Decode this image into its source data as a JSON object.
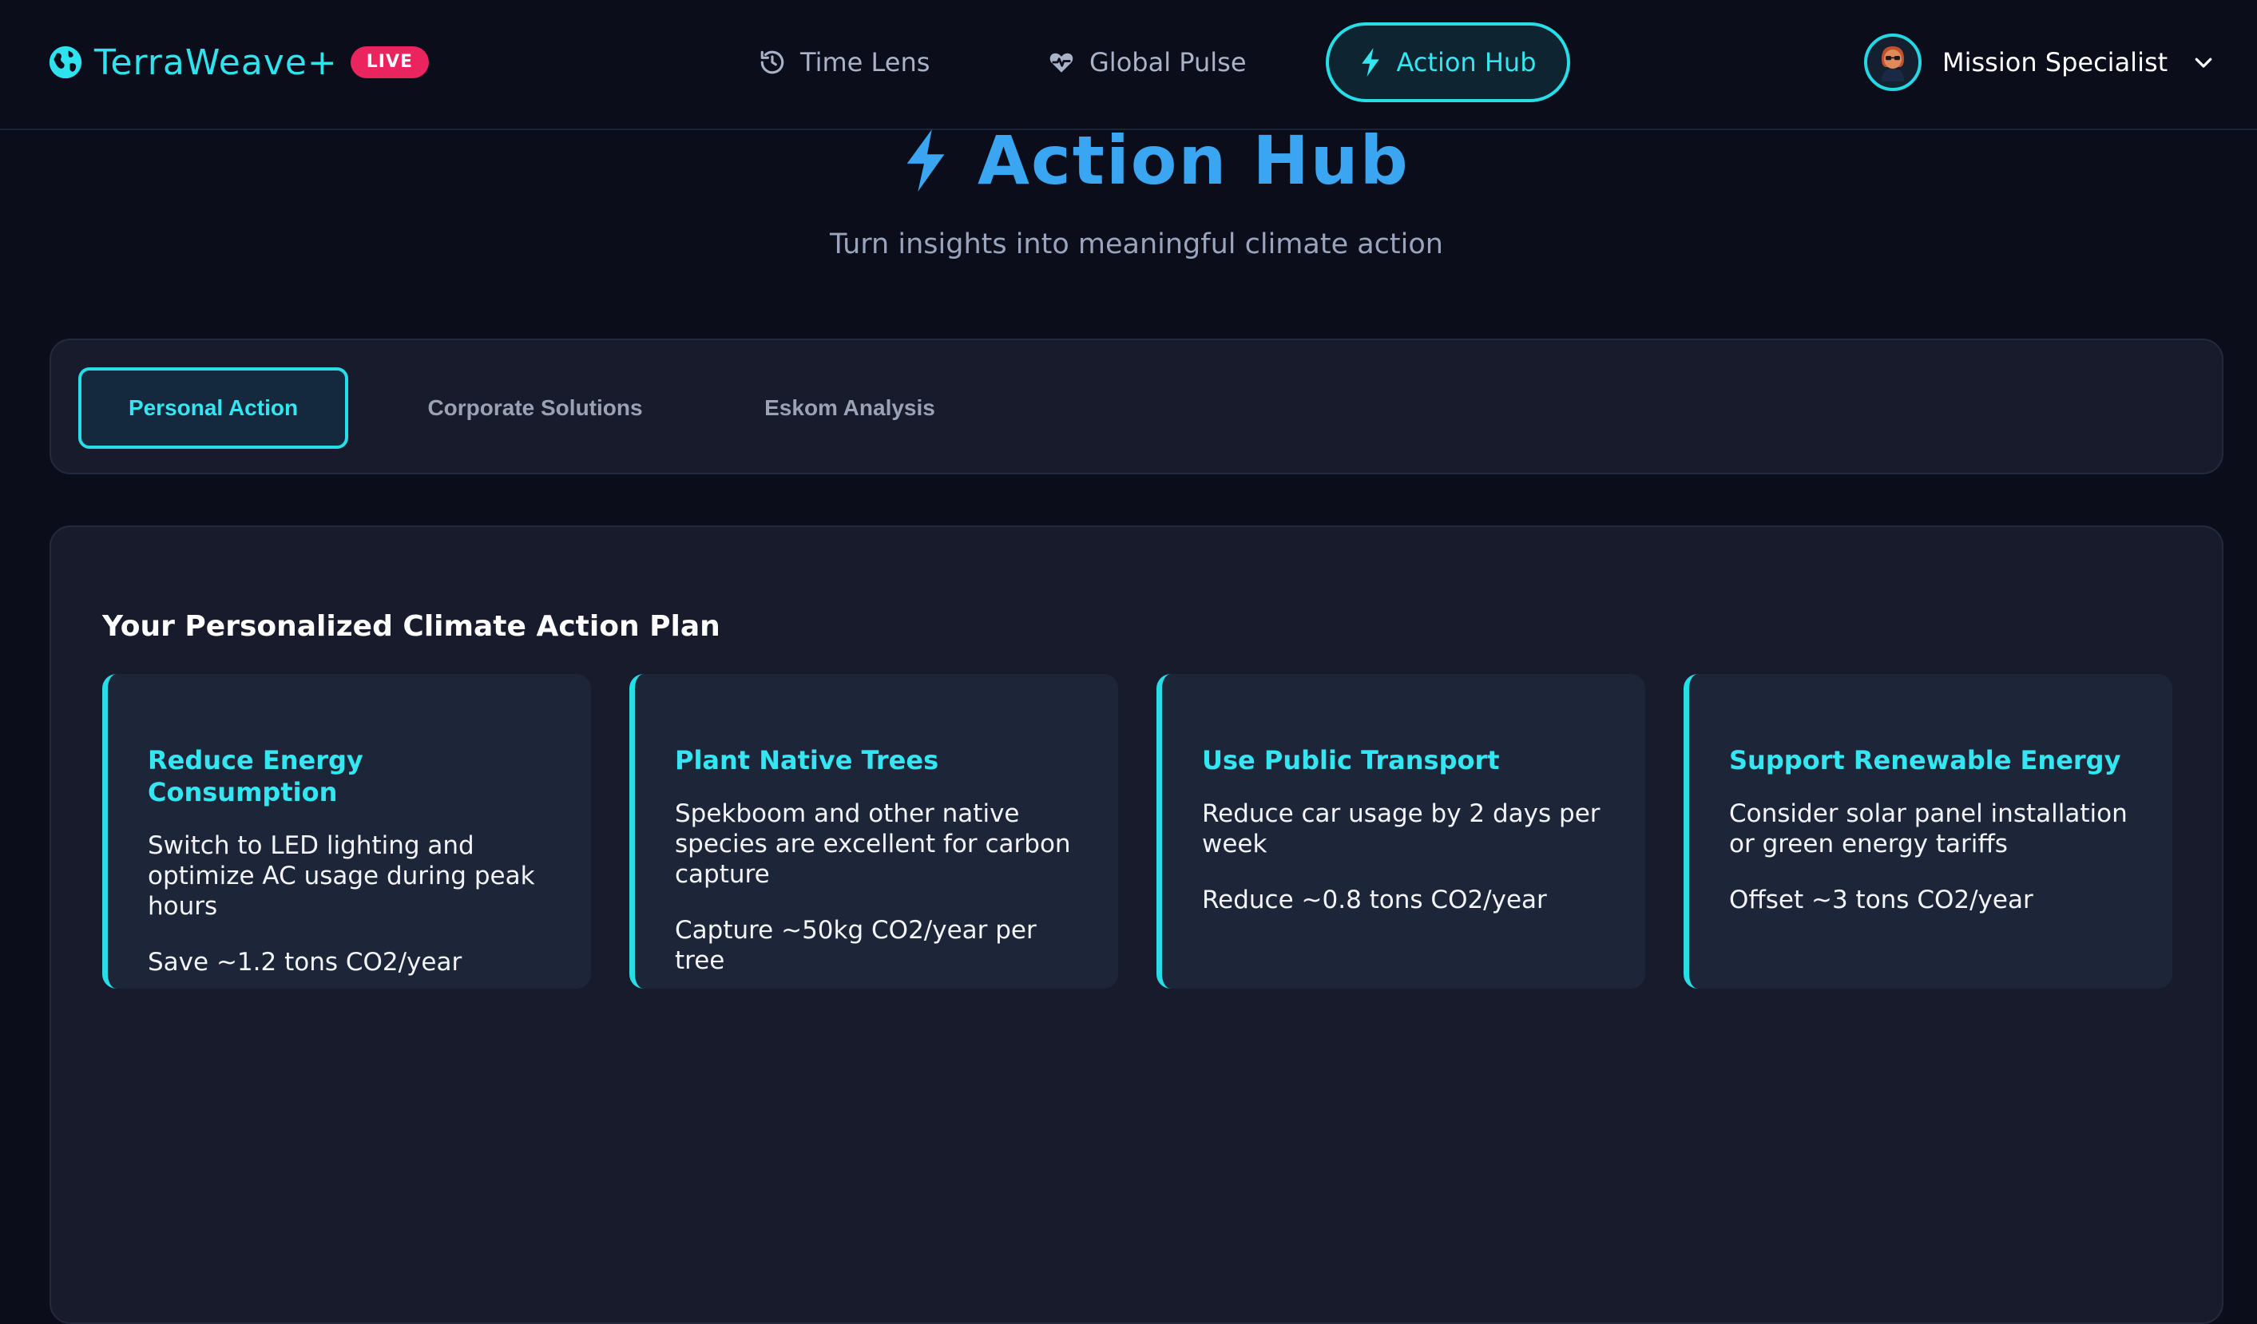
{
  "brand": {
    "name": "TerraWeave+",
    "badge": "LIVE"
  },
  "nav": {
    "items": [
      {
        "label": "Time Lens",
        "icon": "history-icon"
      },
      {
        "label": "Global Pulse",
        "icon": "heart-pulse-icon"
      },
      {
        "label": "Action Hub",
        "icon": "bolt-icon",
        "active": true
      }
    ]
  },
  "user": {
    "name": "Mission Specialist"
  },
  "hero": {
    "title": "Action Hub",
    "subtitle": "Turn insights into meaningful climate action"
  },
  "tabs": [
    {
      "label": "Personal Action",
      "active": true
    },
    {
      "label": "Corporate Solutions"
    },
    {
      "label": "Eskom Analysis"
    }
  ],
  "plan": {
    "title": "Your Personalized Climate Action Plan",
    "cards": [
      {
        "title": "Reduce Energy Consumption",
        "description": "Switch to LED lighting and optimize AC usage during peak hours",
        "impact": "Save ~1.2 tons CO2/year"
      },
      {
        "title": "Plant Native Trees",
        "description": "Spekboom and other native species are excellent for carbon capture",
        "impact": "Capture ~50kg CO2/year per tree"
      },
      {
        "title": "Use Public Transport",
        "description": "Reduce car usage by 2 days per week",
        "impact": "Reduce ~0.8 tons CO2/year"
      },
      {
        "title": "Support Renewable Energy",
        "description": "Consider solar panel installation or green energy tariffs",
        "impact": "Offset ~3 tons CO2/year"
      }
    ]
  },
  "colors": {
    "background": "#0b0d1b",
    "panel": "#181b2c",
    "card": "#1d2639",
    "accent_cyan": "#27dde8",
    "accent_blue": "#3aa6f2",
    "live_badge": "#e9245e"
  }
}
